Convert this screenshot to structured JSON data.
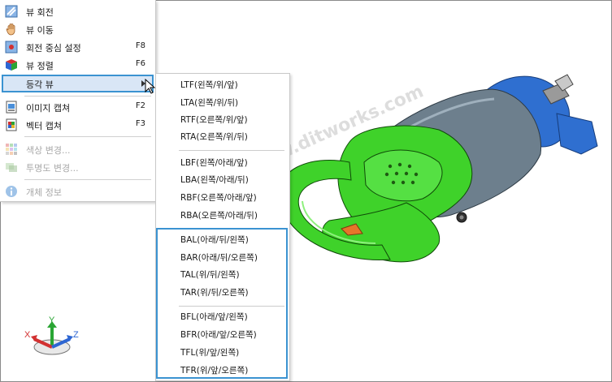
{
  "context_menu": {
    "items": [
      {
        "label": "뷰 회전",
        "shortcut": "",
        "icon": "rotate-view-icon",
        "enabled": true
      },
      {
        "label": "뷰 이동",
        "shortcut": "",
        "icon": "hand-pan-icon",
        "enabled": true
      },
      {
        "label": "회전 중심 설정",
        "shortcut": "F8",
        "icon": "rotation-center-icon",
        "enabled": true
      },
      {
        "label": "뷰 정렬",
        "shortcut": "F6",
        "icon": "view-align-cube-icon",
        "enabled": true
      },
      {
        "label": "등각 뷰",
        "shortcut": "",
        "icon": "",
        "enabled": true,
        "has_submenu": true,
        "selected": true
      },
      {
        "label": "이미지 캡쳐",
        "shortcut": "F2",
        "icon": "image-capture-icon",
        "enabled": true
      },
      {
        "label": "벡터 캡쳐",
        "shortcut": "F3",
        "icon": "vector-capture-icon",
        "enabled": true
      },
      {
        "label": "색상 변경...",
        "shortcut": "",
        "icon": "color-palette-icon",
        "enabled": false
      },
      {
        "label": "투명도 변경...",
        "shortcut": "",
        "icon": "transparency-icon",
        "enabled": false
      },
      {
        "label": "개체 정보",
        "shortcut": "",
        "icon": "info-icon",
        "enabled": false
      }
    ]
  },
  "submenu": {
    "groups": [
      [
        "LTF(왼쪽/위/앞)",
        "LTA(왼쪽/위/뒤)",
        "RTF(오른쪽/위/앞)",
        "RTA(오른쪽/위/뒤)"
      ],
      [
        "LBF(왼쪽/아래/앞)",
        "LBA(왼쪽/아래/뒤)",
        "RBF(오른쪽/아래/앞)",
        "RBA(오른쪽/아래/뒤)"
      ],
      [
        "BAL(아래/뒤/왼쪽)",
        "BAR(아래/뒤/오른쪽)",
        "TAL(위/뒤/왼쪽)",
        "TAR(위/뒤/오른쪽)"
      ],
      [
        "BFL(아래/앞/왼쪽)",
        "BFR(아래/앞/오른쪽)",
        "TFL(위/앞/왼쪽)",
        "TFR(위/앞/오른쪽)"
      ]
    ]
  },
  "axis_triad": {
    "x": "X",
    "y": "Y",
    "z": "Z"
  },
  "watermark": "www.ditworks.com",
  "colors": {
    "accent": "#3b93d1",
    "selection_bg": "#d9e6f6",
    "model_green": "#3fd22a",
    "model_gray": "#6d7f8d",
    "model_blue": "#2f6fd0"
  }
}
